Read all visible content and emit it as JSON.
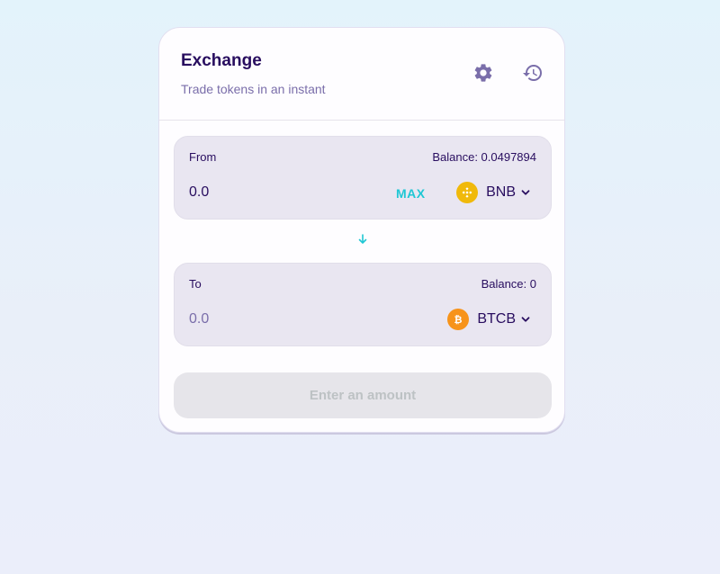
{
  "header": {
    "title": "Exchange",
    "subtitle": "Trade tokens in an instant",
    "settings_icon": "gear-icon",
    "history_icon": "history-icon"
  },
  "from": {
    "label": "From",
    "balance": "Balance: 0.0497894",
    "amount_placeholder": "0.0",
    "max_label": "MAX",
    "token": {
      "symbol": "BNB",
      "icon": "bnb-icon",
      "color": "#f0b90b"
    }
  },
  "to": {
    "label": "To",
    "balance": "Balance: 0",
    "amount_placeholder": "0.0",
    "token": {
      "symbol": "BTCB",
      "icon": "btc-icon",
      "color": "#f7931a"
    }
  },
  "switch_icon": "arrow-down-icon",
  "submit_label": "Enter an amount",
  "colors": {
    "primary_text": "#280d5f",
    "secondary_text": "#7a6eaa",
    "accent": "#1fc7d4",
    "panel_bg": "#e9e6f1",
    "disabled_button": "#e6e5ea"
  }
}
